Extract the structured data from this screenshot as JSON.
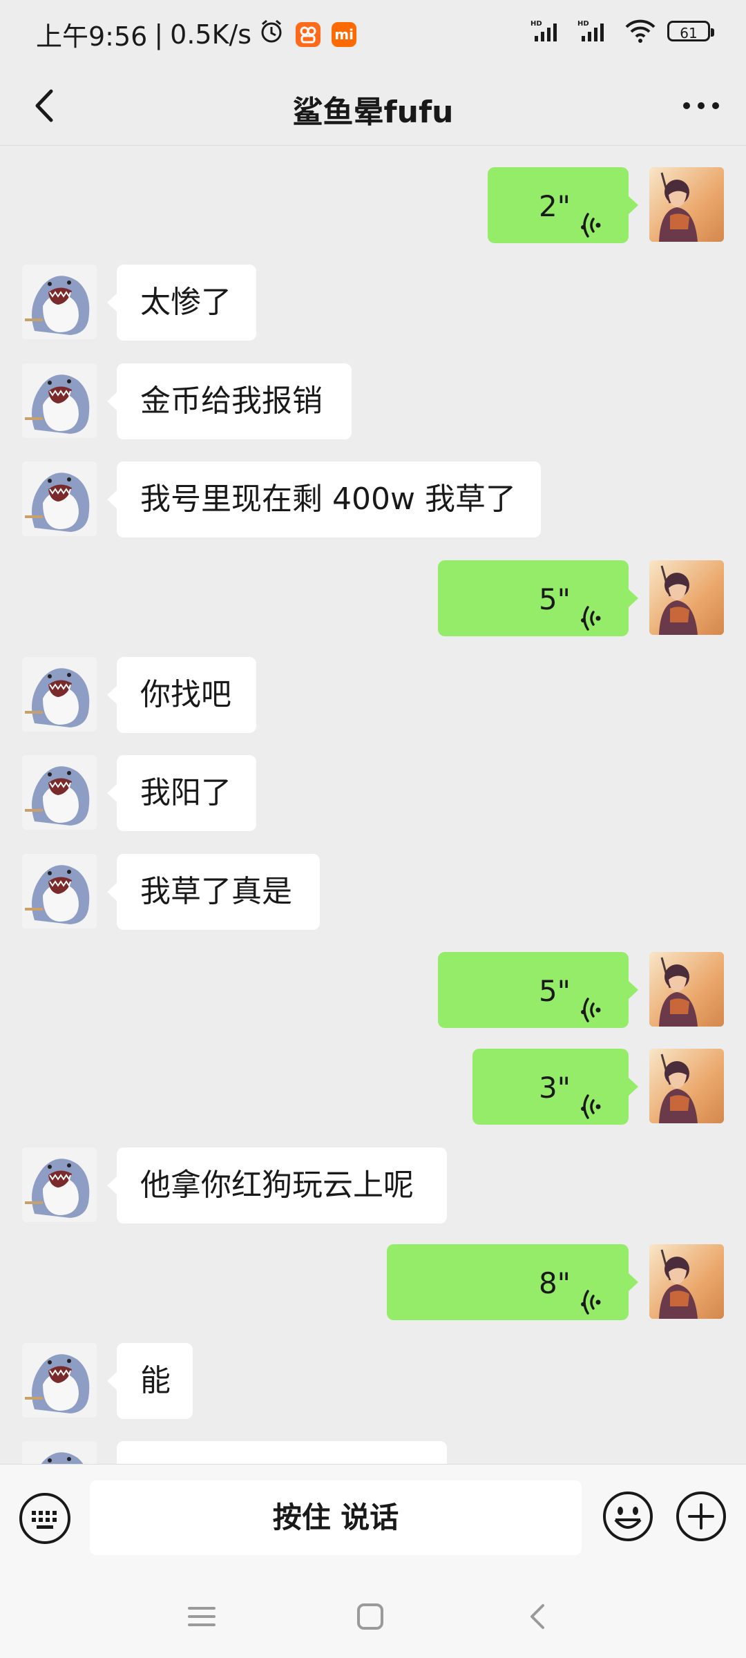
{
  "status_bar": {
    "time": "上午9:56",
    "speed": "0.5K/s",
    "battery": "61",
    "icons": [
      "alarm-icon",
      "app-notification-icon",
      "mi-app-icon",
      "hd-signal-icon",
      "hd-signal-icon",
      "wifi-icon",
      "battery-icon"
    ]
  },
  "header": {
    "title": "鲨鱼晕fufu",
    "back_icon": "chevron-left-icon",
    "more_icon": "more-dots-icon"
  },
  "messages": [
    {
      "side": "out",
      "type": "voice",
      "duration": "2\""
    },
    {
      "side": "in",
      "type": "text",
      "text": "太惨了"
    },
    {
      "side": "in",
      "type": "text",
      "text": "金币给我报销"
    },
    {
      "side": "in",
      "type": "text",
      "text": "我号里现在剩 400w 我草了"
    },
    {
      "side": "out",
      "type": "voice",
      "duration": "5\""
    },
    {
      "side": "in",
      "type": "text",
      "text": "你找吧"
    },
    {
      "side": "in",
      "type": "text",
      "text": "我阳了"
    },
    {
      "side": "in",
      "type": "text",
      "text": "我草了真是"
    },
    {
      "side": "out",
      "type": "voice",
      "duration": "5\""
    },
    {
      "side": "out",
      "type": "voice",
      "duration": "3\""
    },
    {
      "side": "in",
      "type": "text",
      "text": "他拿你红狗玩云上呢"
    },
    {
      "side": "out",
      "type": "voice",
      "duration": "8\""
    },
    {
      "side": "in",
      "type": "text",
      "text": "能"
    },
    {
      "side": "in",
      "type": "text",
      "text": ""
    }
  ],
  "input_bar": {
    "talk_label": "按住 说话",
    "keyboard_icon": "keyboard-icon",
    "emoji_icon": "emoji-icon",
    "plus_icon": "plus-icon"
  },
  "system_nav": {
    "icons": [
      "menu-icon",
      "home-icon",
      "back-icon"
    ]
  },
  "colors": {
    "background": "#ededed",
    "outgoing_bubble": "#95ec69",
    "incoming_bubble": "#ffffff"
  }
}
